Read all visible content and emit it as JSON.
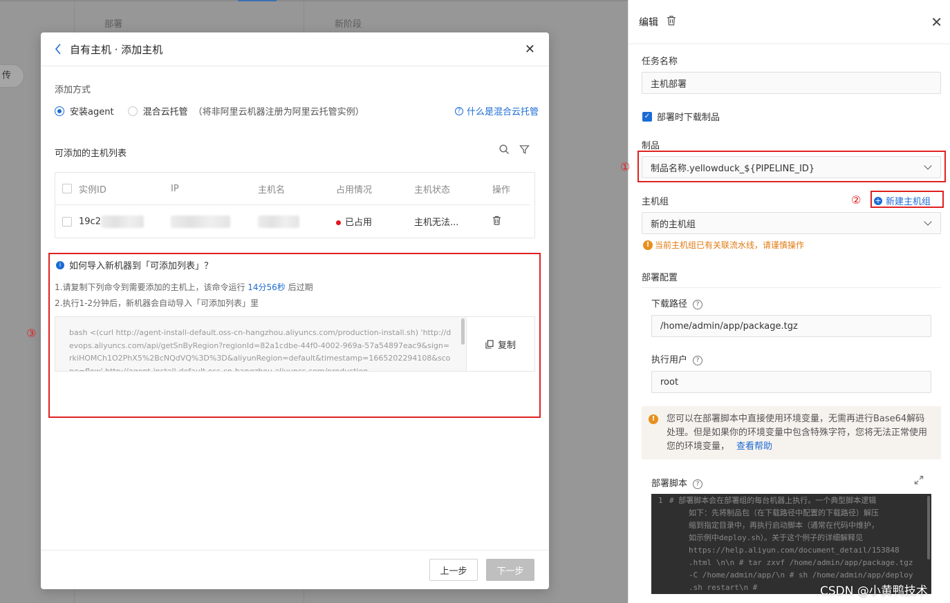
{
  "background": {
    "stage_left": "部署",
    "stage_right": "新阶段",
    "pill_text": "传"
  },
  "modal": {
    "title": "自有主机 · 添加主机",
    "add_method_label": "添加方式",
    "options": [
      "安装agent",
      "混合云托管"
    ],
    "option_note": "（将非阿里云机器注册为阿里云托管实例）",
    "help_link": "什么是混合云托管",
    "list_title": "可添加的主机列表",
    "table": {
      "headers": [
        "实例ID",
        "IP",
        "主机名",
        "占用情况",
        "主机状态",
        "操作"
      ],
      "rows": [
        {
          "id": "19c2",
          "usage": "已占用",
          "status": "主机无法..."
        }
      ]
    },
    "info_title": "如何导入新机器到「可添加列表」？",
    "step1_pre": "1.请复制下列命令到需要添加的主机上，该命令运行",
    "step1_time": "14分56秒",
    "step1_post": "后过期",
    "step2": "2.执行1-2分钟后，新机器会自动导入「可添加列表」里",
    "command": "bash <(curl http://agent-install-default.oss-cn-hangzhou.aliyuncs.com/production-install.sh) 'http://devops.aliyuncs.com/api/getSnByRegion?regionId=82a1cdbe-44f0-4002-969a-57a54897eac9&sign=rkiHOMCh1O2PhX5%2BcNQdVQ%3D%3D&aliyunRegion=default&timestamp=1665202294108&scope=flow' http://agent-install-default.oss-cn-hangzhou.aliyuncs.com/production-",
    "copy_label": "复制",
    "prev_label": "上一步",
    "next_label": "下一步"
  },
  "annotations": [
    "①",
    "②",
    "③"
  ],
  "panel": {
    "title": "编辑",
    "task_name_label": "任务名称",
    "task_name_value": "主机部署",
    "download_checkbox": "部署时下载制品",
    "artifact_label": "制品",
    "artifact_value": "制品名称.yellowduck_${PIPELINE_ID}",
    "host_group_label": "主机组",
    "new_host_group": "新建主机组",
    "host_group_value": "新的主机组",
    "host_group_warning": "当前主机组已有关联流水线，请谨慎操作",
    "deploy_config_label": "部署配置",
    "download_path_label": "下载路径",
    "download_path_value": "/home/admin/app/package.tgz",
    "exec_user_label": "执行用户",
    "exec_user_value": "root",
    "notice_text": "您可以在部署脚本中直接使用环境变量，无需再进行Base64解码处理。但是如果你的环境变量中包含特殊字符，您将无法正常使用您的环境变量，",
    "notice_link": "查看帮助",
    "script_label": "部署脚本",
    "script_line_number": "1",
    "script_lines": [
      "# 部署脚本会在部署组的每台机器上执行。一个典型脚本逻辑",
      "如下：先将制品包（在下载路径中配置的下载路径）解压",
      "缩到指定目录中，再执行启动脚本（通常在代码中维护，",
      "如示例中deploy.sh）。关于这个例子的详细解释见",
      "https://help.aliyun.com/document_detail/153848",
      ".html \\n\\n # tar zxvf /home/admin/app/package.tgz",
      "-C /home/admin/app/\\n # sh /home/admin/app/deploy",
      ".sh restart\\n #"
    ]
  },
  "watermark": "CSDN @小黄鸭技术",
  "colors": {
    "accent": "#1b6bd4",
    "annotation": "#e02020",
    "warning": "#e07a12",
    "occupied": "#e0161b"
  }
}
